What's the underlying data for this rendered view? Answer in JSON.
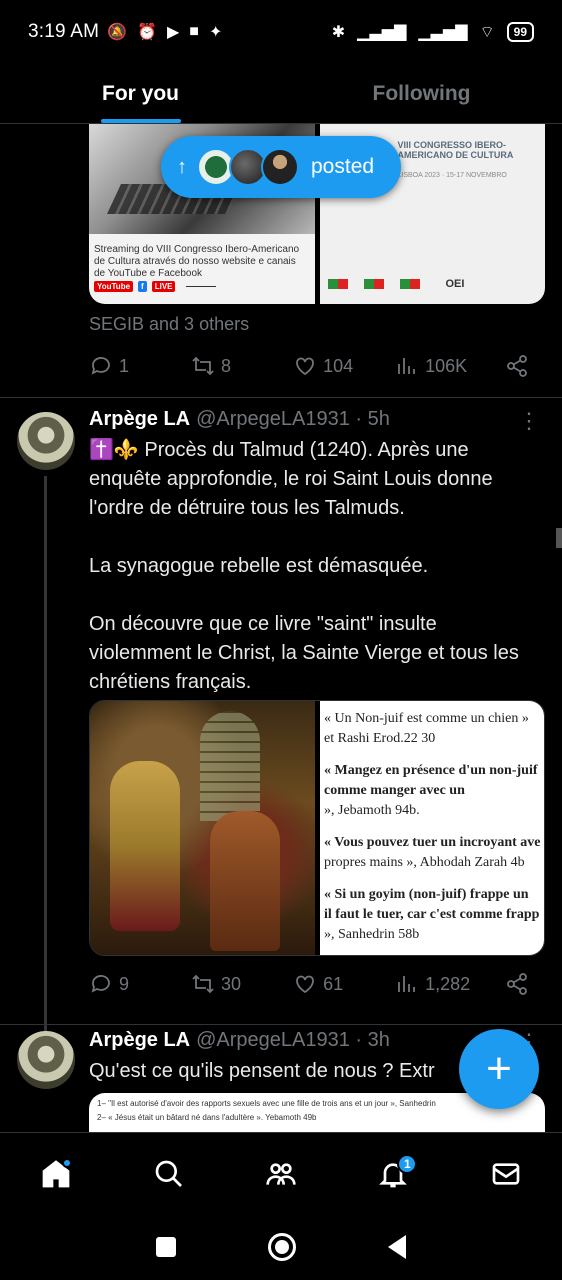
{
  "status_bar": {
    "time": "3:19 AM",
    "battery": "99",
    "left_icons": [
      "mute-icon",
      "alarm-icon",
      "play-icon",
      "video-icon",
      "app-icon"
    ],
    "right_icons": [
      "bluetooth-icon",
      "signal-icon",
      "signal-icon",
      "wifi-icon",
      "battery-icon"
    ]
  },
  "tabs": [
    {
      "label": "For you",
      "active": true
    },
    {
      "label": "Following",
      "active": false
    }
  ],
  "posted_pill": {
    "label": "posted"
  },
  "post0": {
    "media_left": {
      "caption": "Streaming do VIII Congresso Ibero-Americano de Cultura através do nosso website e canais de YouTube e Facebook",
      "yt": "YouTube",
      "fb": "f",
      "live": "LIVE"
    },
    "media_right": {
      "title": "VIII CONGRESSO IBERO-AMERICANO DE CULTURA",
      "subtitle": "LISBOA 2023 · 15-17 NOVEMBRO",
      "logo_oei": "OEI"
    },
    "social_context": "SEGIB and 3 others",
    "actions": {
      "replies": "1",
      "reposts": "8",
      "likes": "104",
      "views": "106K"
    }
  },
  "post1": {
    "name": "Arpège LA",
    "handle": "@ArpegeLA1931 · 5h",
    "text": "✝️⚜️ Procès du Talmud (1240). Après une enquête approfondie, le roi Saint Louis donne l'ordre de détruire tous les Talmuds.\n\nLa synagogue rebelle est démasquée.\n\nOn découvre que ce livre \"saint\" insulte violemment le Christ, la Sainte Vierge et tous les chrétiens français.",
    "quotes": [
      {
        "line1": "« Un Non-juif est comme un chien »",
        "line2": "et Rashi Erod.22 30"
      },
      {
        "line1": "« Mangez en présence d'un non-juif",
        "line2": "comme manger avec un",
        "line3": "», Jebamoth 94b."
      },
      {
        "line1": "« Vous pouvez tuer un incroyant ave",
        "line2": "propres mains », Abhodah Zarah 4b"
      },
      {
        "line1": "« Si un goyim (non-juif) frappe un",
        "line2": "il faut le tuer, car c'est comme frapp",
        "line3": "», Sanhedrin 58b"
      }
    ],
    "actions": {
      "replies": "9",
      "reposts": "30",
      "likes": "61",
      "views": "1,282"
    }
  },
  "post2": {
    "name": "Arpège LA",
    "handle": "@ArpegeLA1931 · 3h",
    "text": "Qu'est ce qu'ils pensent de nous ? Extr",
    "media_lines": [
      "1– \"Il est autorisé d'avoir des rapports sexuels avec une fille de trois ans et un jour », Sanhedrin",
      "2– « Jésus était un bâtard né dans l'adultère ». Yebamoth 49b"
    ]
  },
  "fab": {
    "label": "+"
  },
  "bottom_nav": {
    "notifications_badge": "1"
  }
}
